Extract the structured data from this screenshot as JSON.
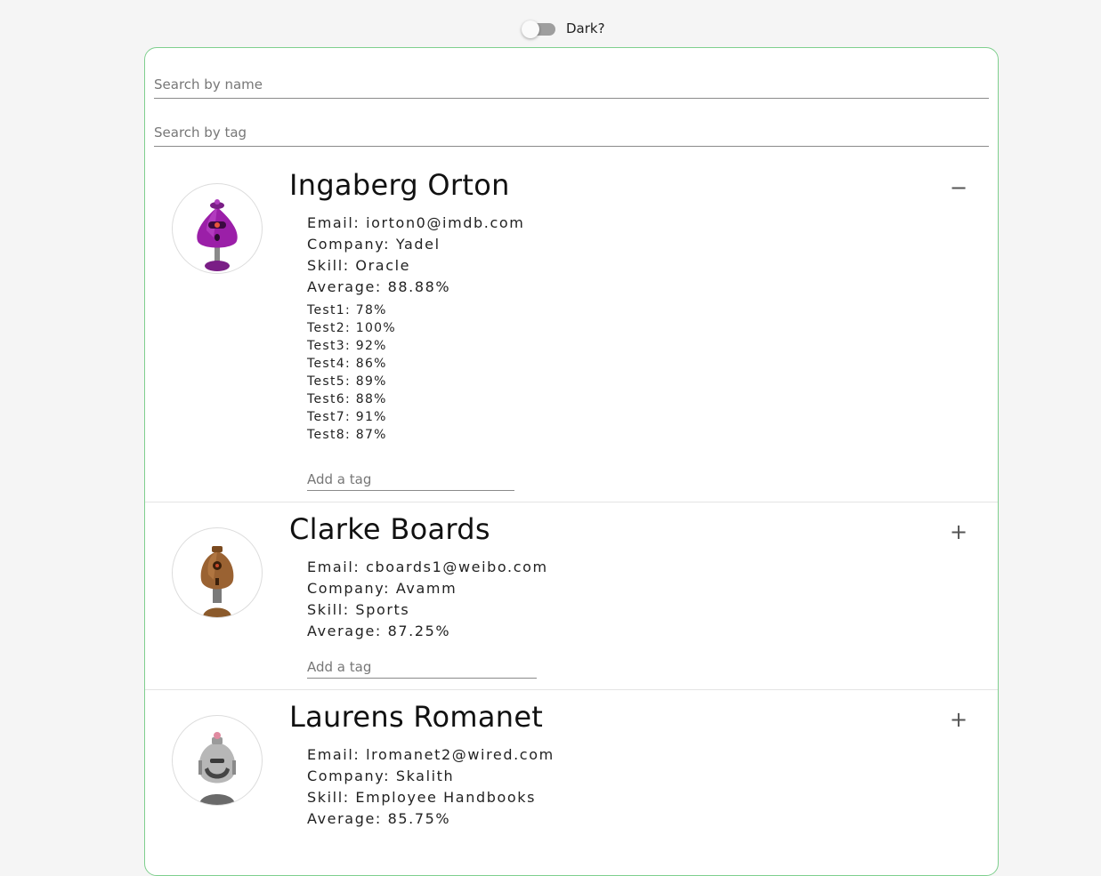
{
  "theme_toggle": {
    "label": "Dark?",
    "checked": false
  },
  "search": {
    "name_placeholder": "Search by name",
    "tag_placeholder": "Search by tag"
  },
  "students": [
    {
      "name": "Ingaberg Orton",
      "email": "Email: iorton0@imdb.com",
      "company": "Company: Yadel",
      "skill": "Skill: Oracle",
      "average": "Average: 88.88%",
      "expanded": true,
      "toggle_icon": "−",
      "avatar_icon": "purple-robot-avatar",
      "tests": [
        "Test1: 78%",
        "Test2: 100%",
        "Test3: 92%",
        "Test4: 86%",
        "Test5: 89%",
        "Test6: 88%",
        "Test7: 91%",
        "Test8: 87%"
      ],
      "tag_placeholder": "Add a tag"
    },
    {
      "name": "Clarke Boards",
      "email": "Email: cboards1@weibo.com",
      "company": "Company: Avamm",
      "skill": "Skill: Sports",
      "average": "Average: 87.25%",
      "expanded": false,
      "toggle_icon": "+",
      "avatar_icon": "brown-robot-avatar",
      "tag_placeholder": "Add a tag"
    },
    {
      "name": "Laurens Romanet",
      "email": "Email: lromanet2@wired.com",
      "company": "Company: Skalith",
      "skill": "Skill: Employee Handbooks",
      "average": "Average: 85.75%",
      "expanded": false,
      "toggle_icon": "+",
      "avatar_icon": "gray-robot-avatar"
    }
  ],
  "colors": {
    "card_border": "#7fcf8e",
    "background": "#f5f5f5"
  }
}
